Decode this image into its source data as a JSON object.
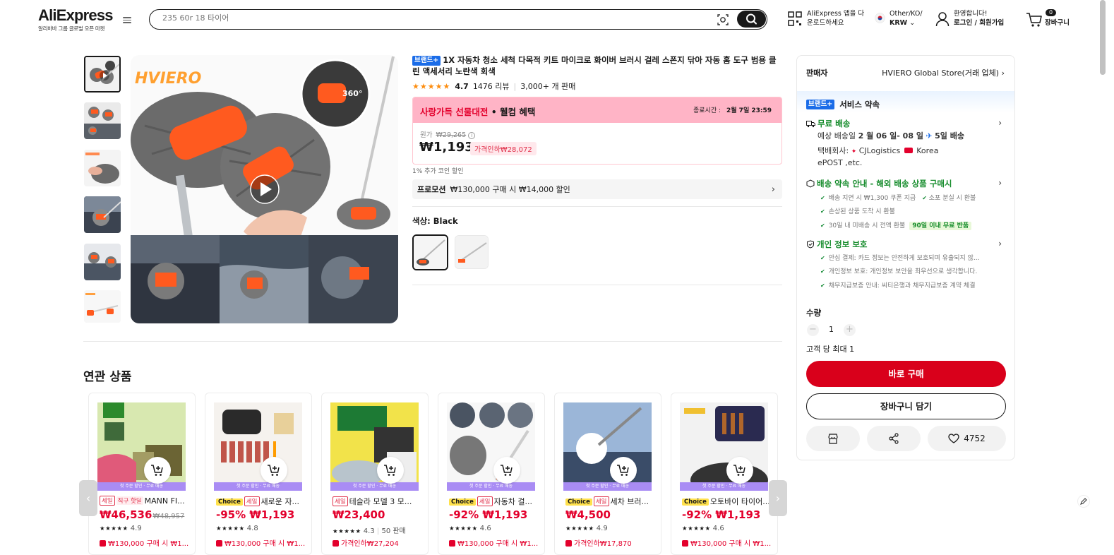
{
  "header": {
    "logo": "AliExpress",
    "logo_sub": "알리바바 그룹 글로벌 오픈 마켓",
    "search_placeholder": "235 60r 18 타이어",
    "app_line1": "AliExpress 앱을 다",
    "app_line2": "운로드하세요",
    "region_line1": "Other/KO/",
    "region_line2": "KRW",
    "account_line1": "환영합니다!",
    "account_line2": "로그인 / 회원가입",
    "cart_count": "0",
    "cart_label": "장바구니"
  },
  "product": {
    "brand_tag": "브랜드+",
    "title": "1X 자동차 청소 세척 다목적 키트 마이크로 화이버 브러시 걸레 스폰지 닦아 자동 홈 도구 범용 클린 액세서리 노란색 회색",
    "stars": "★★★★★",
    "rating": "4.7",
    "reviews": "1476 리뷰",
    "sold": "3,000+ 개 판매",
    "promo_title_a": "사랑가득 선물대전",
    "promo_title_b": " • 웰컴 혜택",
    "promo_end_label": "종료시간 :",
    "promo_end_time": "2월 7일 23:59",
    "original_label": "원가",
    "original_price": "₩29,265",
    "price": "₩1,193",
    "price_drop": "가격인하₩28,072",
    "coin_text": "1% 추가 코인 할인",
    "promotion_label": "프로모션",
    "promotion_text": "₩130,000 구매 시 ₩14,000 할인",
    "color_label": "색상: Black",
    "image_brand": "HVIERO",
    "image_badge": "360°"
  },
  "panel": {
    "seller_label": "판매자",
    "seller_name": "HVIERO Global Store(거래 업체)",
    "brand_tag": "브랜드+",
    "service_title": "서비스 약속",
    "free_ship": "무료 배송",
    "delivery_prefix": "예상 배송일 ",
    "delivery_date": "2 월 06 일- 08 일",
    "delivery_days": "5일 배송",
    "carrier_label": "택배회사: ",
    "carrier1": "CJLogistics",
    "carrier2": "Korea",
    "carrier3": "ePOST ,etc.",
    "guide_title": "배송 약속 안내 - 해외 배송 상품 구매시",
    "guide1a": "배송 지연 시 ₩1,300 쿠폰 지급",
    "guide1b": "소포 분실 시 환불",
    "guide2": "손상된 상품 도착 시 환불",
    "guide3": "30일 내 미배송 시 전액 환불",
    "guide3_chip": "90일 이내 무료 반품",
    "privacy_title": "개인 정보 보호",
    "privacy1": "안심 결제: 카드 정보는 안전하게 보호되며 유출되지 않...",
    "privacy2": "개인정보 보호: 개인정보 보안을 최우선으로 생각합니다.",
    "privacy3": "채무지급보증 안내: 씨티은행과 채무지급보증 계약 체결",
    "qty_label": "수량",
    "qty_minus": "−",
    "qty_plus": "+",
    "qty_value": "1",
    "max_label": "고객 당 최대 1",
    "buy_label": "바로 구매",
    "cart_label": "장바구니 담기",
    "wish_count": "4752"
  },
  "related": {
    "title": "연관 상품",
    "band_text": "첫 주문 할인 · 무료 배송",
    "prev": "‹",
    "next": "›",
    "items": [
      {
        "tag1": "세일",
        "tag2": "직구 핫딜",
        "title": "MANN FI...",
        "price": "₩46,536",
        "old": "₩48,957",
        "stars": "★★★★★",
        "rating": "4.9",
        "extra": "",
        "foot": "₩130,000 구매 시 ₩1..."
      },
      {
        "tag1": "Choice",
        "tag2": "세일",
        "title": "새로운 자...",
        "price": "-95% ₩1,193",
        "old": "",
        "stars": "★★★★★",
        "rating": "4.8",
        "extra": "",
        "foot": "₩130,000 구매 시 ₩1..."
      },
      {
        "tag1": "세일",
        "tag2": "",
        "title": "테슬라 모델 3 모...",
        "price": "₩23,400",
        "old": "",
        "stars": "★★★★★",
        "rating": "4.3",
        "extra": "50 판매",
        "foot": "가격인하₩27,204"
      },
      {
        "tag1": "Choice",
        "tag2": "세일",
        "title": "자동차 걸...",
        "price": "-92% ₩1,193",
        "old": "",
        "stars": "★★★★★",
        "rating": "4.6",
        "extra": "",
        "foot": "₩130,000 구매 시 ₩1..."
      },
      {
        "tag1": "Choice",
        "tag2": "세일",
        "title": "세차 브러...",
        "price": "₩4,500",
        "old": "",
        "stars": "★★★★★",
        "rating": "4.9",
        "extra": "",
        "foot": "가격인하₩17,870"
      },
      {
        "tag1": "Choice",
        "tag2": "",
        "title": "오토바이 타이어...",
        "price": "-92% ₩1,193",
        "old": "",
        "stars": "★★★★★",
        "rating": "4.6",
        "extra": "",
        "foot": "₩130,000 구매 시 ₩1..."
      }
    ]
  },
  "colors": {
    "accent": "#d9001b",
    "brand": "#1a6ce8",
    "green": "#168c2c",
    "promo_pink": "#ffb4c6",
    "band_purple": "#a98cf4"
  }
}
